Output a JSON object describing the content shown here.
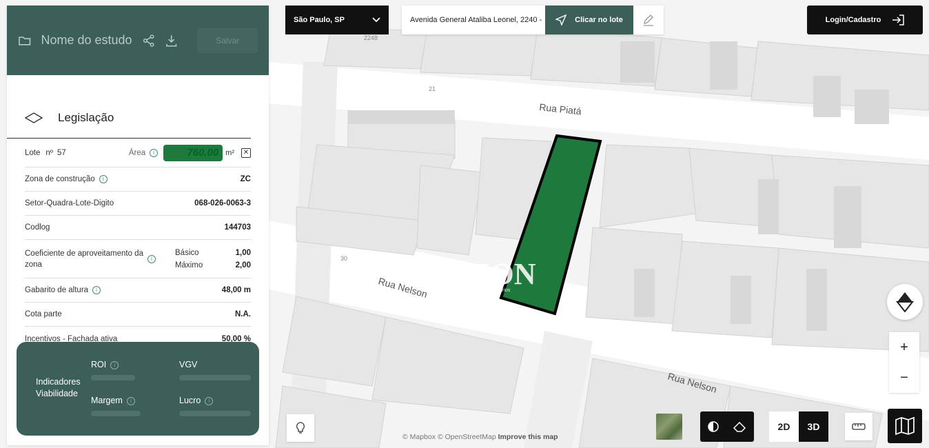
{
  "map": {
    "streets": [
      "Rua Piatá",
      "Rua Nelson",
      "Rua Nelson"
    ],
    "numbers": [
      "2248",
      "21",
      "30"
    ],
    "watermark": "ZION",
    "watermark_sub": "Imobiliários"
  },
  "panel": {
    "study_name": "Nome do estudo",
    "save_label": "Salvar",
    "section_title": "Legislação",
    "lote_label": "Lote",
    "lote_prefix": "nº",
    "lote_number": "57",
    "area_label": "Área",
    "area_value": "760,00",
    "area_unit": "m²",
    "rows": [
      {
        "label": "Zona de construção",
        "value": "ZC"
      },
      {
        "label": "Setor-Quadra-Lote-Digito",
        "value": "068-026-0063-3"
      },
      {
        "label": "Codlog",
        "value": "144703"
      },
      {
        "label": "Coeficiente de aproveitamento da zona",
        "basic_label": "Básico",
        "basic_value": "1,00",
        "max_label": "Máximo",
        "max_value": "2,00"
      },
      {
        "label": "Gabarito de altura",
        "value": "48,00 m"
      },
      {
        "label": "Cota parte",
        "value": "N.A."
      },
      {
        "label": "Incentivos - Fachada ativa",
        "value": "50,00 %"
      }
    ]
  },
  "indicators": {
    "title": "Indicadores Viabilidade",
    "roi": "ROI",
    "vgv": "VGV",
    "margin": "Margem",
    "profit": "Lucro"
  },
  "topbar": {
    "city": "São Paulo, SP",
    "address": "Avenida General Ataliba Leonel, 2240 -",
    "click_label": "Clicar no lote",
    "login_label": "Login/Cadastro"
  },
  "controls": {
    "zoom_in": "+",
    "zoom_out": "−",
    "mode_2d": "2D",
    "mode_3d": "3D"
  },
  "attribution": {
    "mapbox": "© Mapbox",
    "osm": "© OpenStreetMap",
    "improve": "Improve this map"
  },
  "colors": {
    "brand": "#3d5f5a",
    "lot_fill": "#1e7a3c",
    "dark": "#111111"
  }
}
